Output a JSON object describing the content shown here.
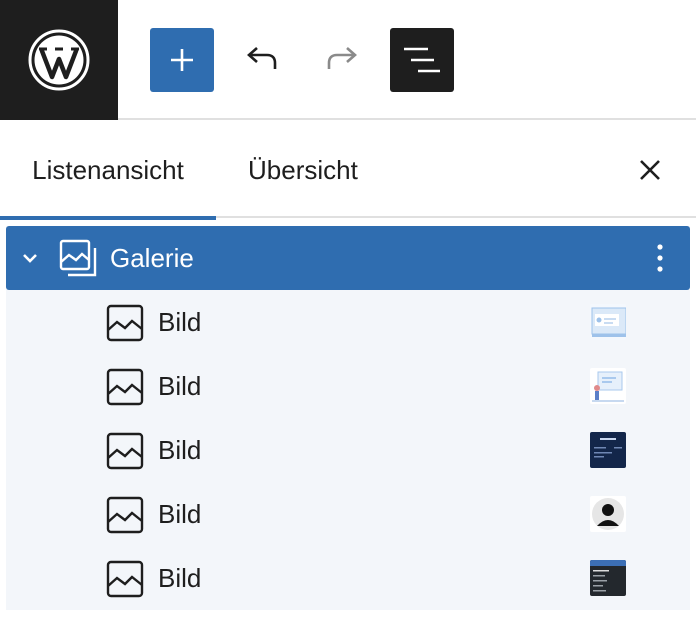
{
  "toolbar": {
    "logo_icon": "wordpress-logo",
    "add_icon": "plus-icon",
    "undo_icon": "undo-icon",
    "redo_icon": "redo-icon",
    "list_view_icon": "list-view-icon",
    "accent_color": "#2f6db0"
  },
  "tabs": {
    "list_label": "Listenansicht",
    "overview_label": "Übersicht",
    "close_icon": "close-icon"
  },
  "tree": {
    "parent": {
      "label": "Galerie",
      "icon": "gallery-icon"
    },
    "children": [
      {
        "label": "Bild",
        "icon": "image-icon"
      },
      {
        "label": "Bild",
        "icon": "image-icon"
      },
      {
        "label": "Bild",
        "icon": "image-icon"
      },
      {
        "label": "Bild",
        "icon": "image-icon"
      },
      {
        "label": "Bild",
        "icon": "image-icon"
      }
    ]
  }
}
